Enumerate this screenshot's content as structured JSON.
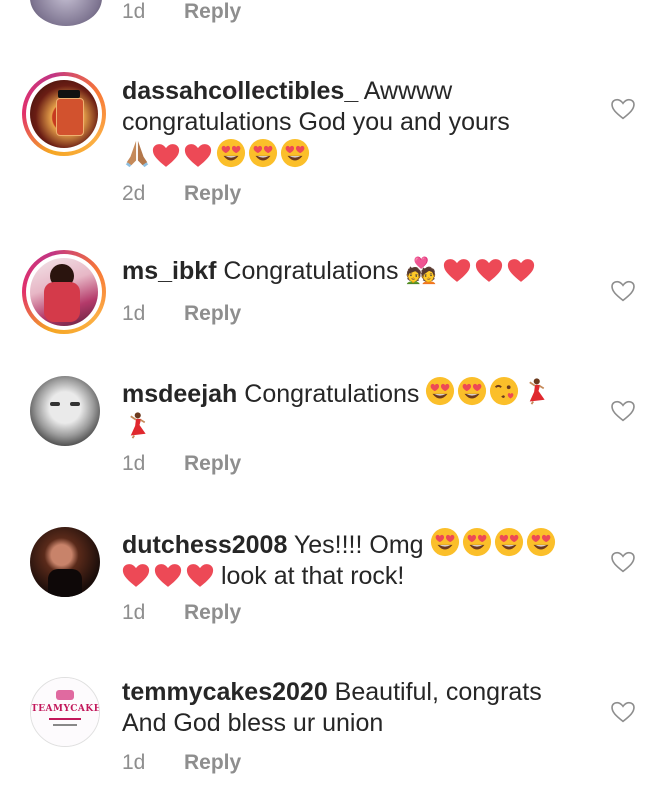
{
  "prev_meta": {
    "time": "1d",
    "reply": "Reply"
  },
  "comments": [
    {
      "username": "dassahcollectibles_",
      "line1": " Awwww",
      "line2": "congratulations God you and yours",
      "time": "2d",
      "reply": "Reply"
    },
    {
      "username": "ms_ibkf",
      "text": " Congratulations 💑",
      "time": "1d",
      "reply": "Reply"
    },
    {
      "username": "msdeejah",
      "text": " Congratulations",
      "time": "1d",
      "reply": "Reply"
    },
    {
      "username": "dutchess2008",
      "text": " Yes!!!! Omg",
      "line2": " look at that rock!",
      "time": "1d",
      "reply": "Reply"
    },
    {
      "username": "temmycakes2020",
      "text": " Beautiful, congrats",
      "line2": "And God bless ur union",
      "time": "1d",
      "reply": "Reply",
      "avatar_text": "TEAMYCAKES"
    }
  ],
  "colors": {
    "heart": "#ed4956",
    "muted": "#8e8e8e",
    "text": "#262626",
    "emoji_face": "#fbbf2a"
  },
  "icons": {
    "like": "heart-outline-icon",
    "love": "red-heart-emoji",
    "heart_eyes": "heart-eyes-emoji",
    "pray": "folded-hands-emoji",
    "kiss": "kissing-face-emoji",
    "dancer": "dancer-emoji"
  }
}
